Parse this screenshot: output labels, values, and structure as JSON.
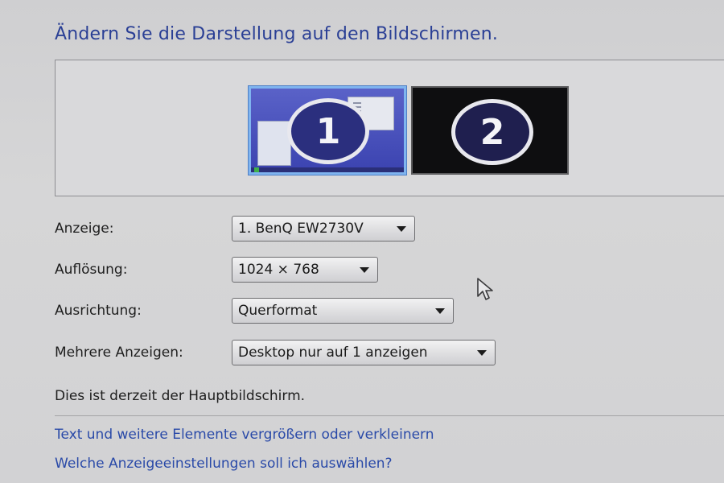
{
  "page": {
    "title": "Ändern Sie die Darstellung auf den Bildschirmen."
  },
  "monitors": [
    {
      "number": "1",
      "selected": true
    },
    {
      "number": "2",
      "selected": false
    }
  ],
  "settings": {
    "anzeige": {
      "label": "Anzeige:",
      "value": "1. BenQ EW2730V"
    },
    "aufloesung": {
      "label": "Auflösung:",
      "value": "1024 × 768"
    },
    "ausrichtung": {
      "label": "Ausrichtung:",
      "value": "Querformat"
    },
    "mehrere": {
      "label": "Mehrere Anzeigen:",
      "value": "Desktop nur auf 1 anzeigen"
    }
  },
  "status": "Dies ist derzeit der Hauptbildschirm.",
  "links": {
    "text_size": "Text und weitere Elemente vergrößern oder verkleinern",
    "which_settings": "Welche Anzeigeeinstellungen soll ich auswählen?"
  },
  "colors": {
    "title": "#2a3f95",
    "link": "#2a4aa8",
    "monitor_selected": "#3b43b0",
    "monitor_selected_border": "#7fb4ef",
    "monitor_inactive": "#0e0e10"
  },
  "icons": [
    "dropdown-arrow-icon",
    "mouse-pointer-icon"
  ]
}
